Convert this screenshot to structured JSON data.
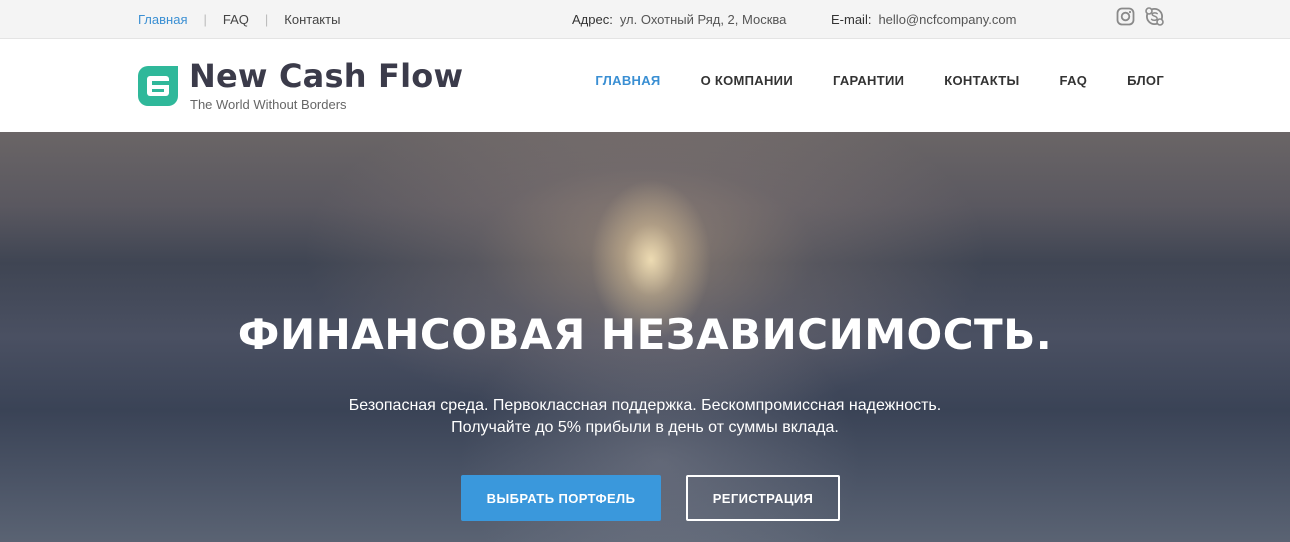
{
  "topbar": {
    "nav": [
      {
        "label": "Главная",
        "active": true
      },
      {
        "label": "FAQ",
        "active": false
      },
      {
        "label": "Контакты",
        "active": false
      }
    ],
    "address_label": "Адрес:",
    "address_value": "ул. Охотный Ряд, 2, Москва",
    "email_label": "E-mail:",
    "email_value": "hello@ncfcompany.com",
    "social_icons": [
      "instagram-icon",
      "skype-icon"
    ]
  },
  "header": {
    "logo_title": "New Cash Flow",
    "logo_subtitle": "The World Without Borders",
    "brand_color": "#2fb89a",
    "nav": [
      {
        "label": "ГЛАВНАЯ",
        "active": true
      },
      {
        "label": "О КОМПАНИИ",
        "active": false
      },
      {
        "label": "ГАРАНТИИ",
        "active": false
      },
      {
        "label": "КОНТАКТЫ",
        "active": false
      },
      {
        "label": "FAQ",
        "active": false
      },
      {
        "label": "БЛОГ",
        "active": false
      }
    ],
    "accent_color": "#3a8fd3"
  },
  "hero": {
    "title": "ФИНАНСОВАЯ НЕЗАВИСИМОСТЬ.",
    "line1": "Безопасная среда. Первоклассная поддержка. Бескомпромиссная надежность.",
    "line2": "Получайте до 5% прибыли в день от суммы вклада.",
    "primary_button": "ВЫБРАТЬ ПОРТФЕЛЬ",
    "secondary_button": "РЕГИСТРАЦИЯ",
    "primary_color": "#3a98dc"
  }
}
